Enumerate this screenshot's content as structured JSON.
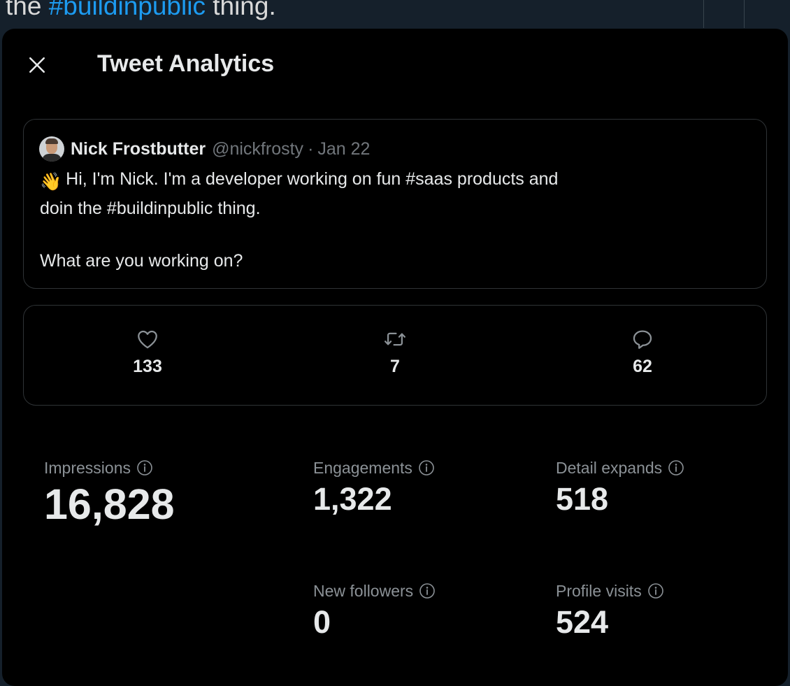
{
  "background": {
    "text_prefix": "the ",
    "hashtag": "#buildinpublic",
    "text_suffix": " thing."
  },
  "modal": {
    "title": "Tweet Analytics",
    "close_icon": "close-icon"
  },
  "tweet": {
    "author_name": "Nick Frostbutter",
    "author_handle": "@nickfrosty",
    "separator": "·",
    "date": "Jan 22",
    "emoji": "👋",
    "line1": "Hi, I'm Nick. I'm a developer working on fun #saas products and",
    "line2": "doin the #buildinpublic thing.",
    "line3": "What are you working on?"
  },
  "engagement": [
    {
      "icon": "heart-icon",
      "value": "133"
    },
    {
      "icon": "retweet-icon",
      "value": "7"
    },
    {
      "icon": "reply-icon",
      "value": "62"
    }
  ],
  "metrics": {
    "impressions": {
      "label": "Impressions",
      "value": "16,828"
    },
    "engagements": {
      "label": "Engagements",
      "value": "1,322"
    },
    "detail_expands": {
      "label": "Detail expands",
      "value": "518"
    },
    "new_followers": {
      "label": "New followers",
      "value": "0"
    },
    "profile_visits": {
      "label": "Profile visits",
      "value": "524"
    }
  },
  "colors": {
    "modal_bg": "#000000",
    "page_bg": "#15202b",
    "text_primary": "#e7e9ea",
    "text_secondary": "#71767b",
    "link": "#1d9bf0",
    "border": "#2f3336"
  }
}
